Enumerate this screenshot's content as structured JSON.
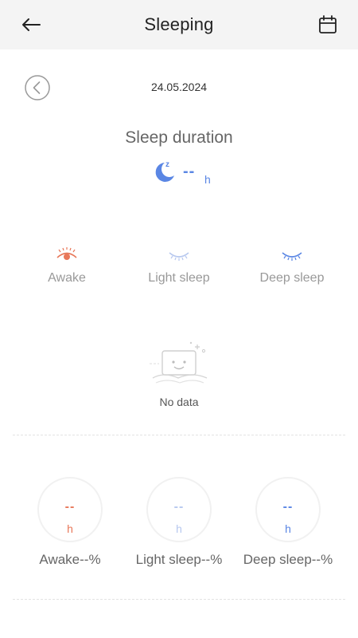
{
  "header": {
    "title": "Sleeping",
    "back_icon": "arrow-left-icon",
    "calendar_icon": "calendar-icon"
  },
  "date_nav": {
    "prev_icon": "chevron-left-icon",
    "date": "24.05.2024"
  },
  "duration": {
    "title": "Sleep duration",
    "value": "--",
    "unit": "h",
    "icon": "moon-icon",
    "color": "#5a86e4"
  },
  "legend": [
    {
      "label": "Awake",
      "icon": "eye-open-icon",
      "color": "#e8785a"
    },
    {
      "label": "Light sleep",
      "icon": "eye-closed-icon",
      "color": "#b7c8ef"
    },
    {
      "label": "Deep sleep",
      "icon": "eye-closed-icon",
      "color": "#5a86e4"
    }
  ],
  "empty_state": {
    "text": "No data",
    "icon": "no-data-pillow-icon"
  },
  "stats": [
    {
      "value": "--",
      "unit": "h",
      "label": "Awake--%",
      "color": "#e8785a"
    },
    {
      "value": "--",
      "unit": "h",
      "label": "Light sleep--%",
      "color": "#b7c8ef"
    },
    {
      "value": "--",
      "unit": "h",
      "label": "Deep sleep--%",
      "color": "#5a86e4"
    }
  ]
}
